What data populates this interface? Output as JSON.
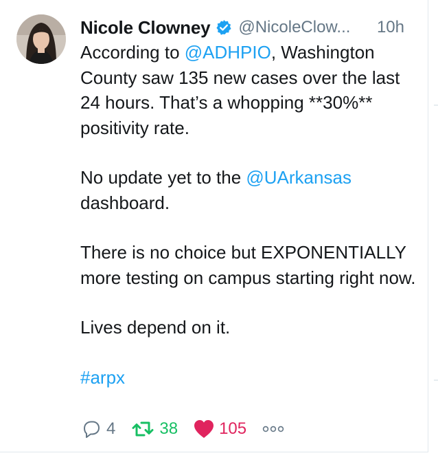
{
  "tweet": {
    "author_name": "Nicole Clowney",
    "author_handle": "@NicoleClow...",
    "timestamp": "10h",
    "text": {
      "line1_before": "According to ",
      "mention1": "@ADHPIO",
      "line1_after": ", Washington County saw 135 new cases over the last 24 hours. That’s a whopping **30%** positivity rate.",
      "p2_before": "No update yet to the ",
      "mention2": "@UArkansas",
      "p2_after": " dashboard.",
      "p3": "There is no choice but EXPONENTIALLY more testing on campus starting right now.",
      "p4": "Lives depend on it.",
      "hashtag": "#arpx"
    },
    "counts": {
      "replies": "4",
      "retweets": "38",
      "likes": "105"
    },
    "icons": {
      "verified": "verified-badge-icon",
      "reply": "reply-icon",
      "retweet": "retweet-icon",
      "like": "heart-icon",
      "more": "more-icon"
    },
    "colors": {
      "link": "#1da1f2",
      "secondary": "#657786",
      "retweet": "#17bf63",
      "like": "#e0245e"
    }
  }
}
